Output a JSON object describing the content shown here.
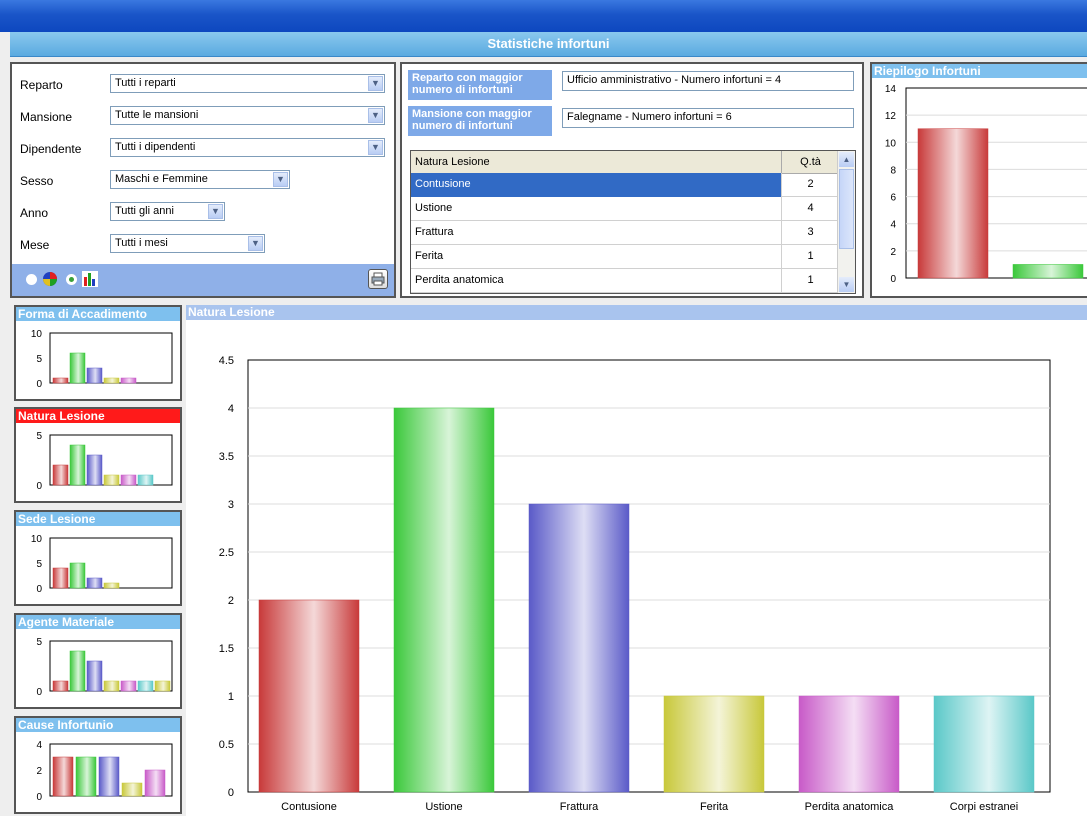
{
  "window": {
    "title": "Statistiche infortuni"
  },
  "filters": [
    {
      "label": "Reparto",
      "value": "Tutti i reparti"
    },
    {
      "label": "Mansione",
      "value": "Tutte le mansioni"
    },
    {
      "label": "Dipendente",
      "value": "Tutti i dipendenti"
    },
    {
      "label": "Sesso",
      "value": "Maschi e Femmine"
    },
    {
      "label": "Anno",
      "value": "Tutti gli anni"
    },
    {
      "label": "Mese",
      "value": "Tutti i mesi"
    }
  ],
  "chart_toggle": {
    "selected": "bar"
  },
  "summary": {
    "reparto_label": "Reparto con maggior numero di infortuni",
    "reparto_value": "Ufficio amministrativo - Numero infortuni = 4",
    "mansione_label": "Mansione con maggior numero di infortuni",
    "mansione_value": "Falegname - Numero infortuni = 6"
  },
  "grid": {
    "headers": [
      "Natura Lesione",
      "Q.tà"
    ],
    "rows": [
      {
        "name": "Contusione",
        "qty": "2"
      },
      {
        "name": "Ustione",
        "qty": "4"
      },
      {
        "name": "Frattura",
        "qty": "3"
      },
      {
        "name": "Ferita",
        "qty": "1"
      },
      {
        "name": "Perdita anatomica",
        "qty": "1"
      }
    ],
    "selected_row": 0
  },
  "colors": {
    "red": "#c83a3a",
    "green": "#3ac83a",
    "blue": "#5a5ac8",
    "yellow": "#c8c83a",
    "magenta": "#c85ac8",
    "cyan": "#5ac8c8",
    "title_blue": "#7ec0ee",
    "title_red": "#ff1a1a"
  },
  "chart_data": [
    {
      "id": "riepilogo",
      "title": "Riepilogo Infortuni",
      "type": "bar",
      "yticks": [
        "14",
        "12",
        "10",
        "8",
        "6",
        "4",
        "2",
        "0"
      ],
      "ylim": [
        0,
        14
      ],
      "values": [
        11,
        1
      ],
      "colors": [
        "red",
        "green"
      ]
    },
    {
      "id": "forma",
      "title": "Forma di Accadimento",
      "type": "bar",
      "yticks": [
        "10",
        "5",
        "0"
      ],
      "ylim": [
        0,
        10
      ],
      "values": [
        1,
        6,
        3,
        1,
        1
      ],
      "colors": [
        "red",
        "green",
        "blue",
        "yellow",
        "magenta"
      ]
    },
    {
      "id": "natura_mini",
      "title": "Natura Lesione",
      "type": "bar",
      "yticks": [
        "5",
        "0"
      ],
      "ylim": [
        0,
        5
      ],
      "values": [
        2,
        4,
        3,
        1,
        1,
        1
      ],
      "colors": [
        "red",
        "green",
        "blue",
        "yellow",
        "magenta",
        "cyan"
      ]
    },
    {
      "id": "sede",
      "title": "Sede Lesione",
      "type": "bar",
      "yticks": [
        "10",
        "5",
        "0"
      ],
      "ylim": [
        0,
        10
      ],
      "values": [
        4,
        5,
        2,
        1
      ],
      "colors": [
        "red",
        "green",
        "blue",
        "yellow"
      ]
    },
    {
      "id": "agente",
      "title": "Agente Materiale",
      "type": "bar",
      "yticks": [
        "5",
        "0"
      ],
      "ylim": [
        0,
        5
      ],
      "values": [
        1,
        4,
        3,
        1,
        1,
        1,
        1
      ],
      "colors": [
        "red",
        "green",
        "blue",
        "yellow",
        "magenta",
        "cyan",
        "yellow"
      ]
    },
    {
      "id": "cause",
      "title": "Cause Infortunio",
      "type": "bar",
      "yticks": [
        "4",
        "2",
        "0"
      ],
      "ylim": [
        0,
        4
      ],
      "values": [
        3,
        3,
        3,
        1,
        2
      ],
      "colors": [
        "red",
        "green",
        "blue",
        "yellow",
        "magenta"
      ]
    },
    {
      "id": "main",
      "title": "Natura Lesione",
      "type": "bar",
      "categories": [
        "Contusione",
        "Ustione",
        "Frattura",
        "Ferita",
        "Perdita anatomica",
        "Corpi estranei"
      ],
      "values": [
        2,
        4,
        3,
        1,
        1,
        1
      ],
      "colors": [
        "red",
        "green",
        "blue",
        "yellow",
        "magenta",
        "cyan"
      ],
      "yticks": [
        "4.5",
        "4",
        "3.5",
        "3",
        "2.5",
        "2",
        "1.5",
        "1",
        "0.5",
        "0"
      ],
      "ylim": [
        0,
        4.5
      ],
      "grid": true
    }
  ]
}
